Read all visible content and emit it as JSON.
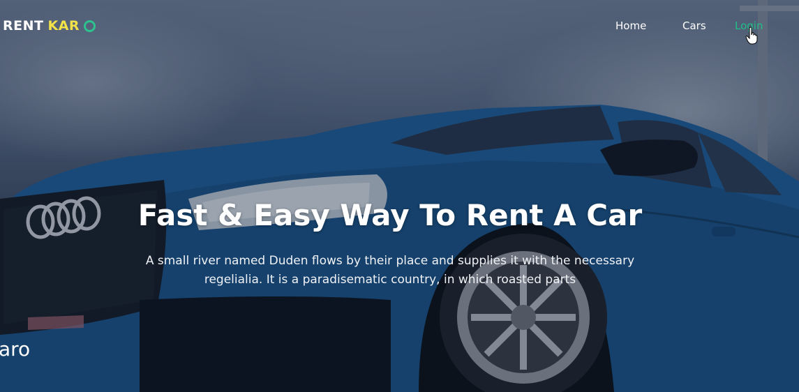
{
  "brand": {
    "part1": "RENT",
    "part2": "KAR"
  },
  "nav": {
    "home": "Home",
    "cars": "Cars",
    "login": "Login"
  },
  "hero": {
    "title": "Fast & Easy Way To Rent A Car",
    "subtitle": "A small river named Duden flows by their place and supplies it with the necessary regelialia. It is a paradisematic country, in which roasted parts"
  },
  "side_text": "aro",
  "colors": {
    "accent_green": "#1fbf87",
    "accent_yellow": "#f2e24a"
  },
  "icons": {
    "cursor": "hand-pointer-icon",
    "logo_mark": "ring-icon"
  }
}
